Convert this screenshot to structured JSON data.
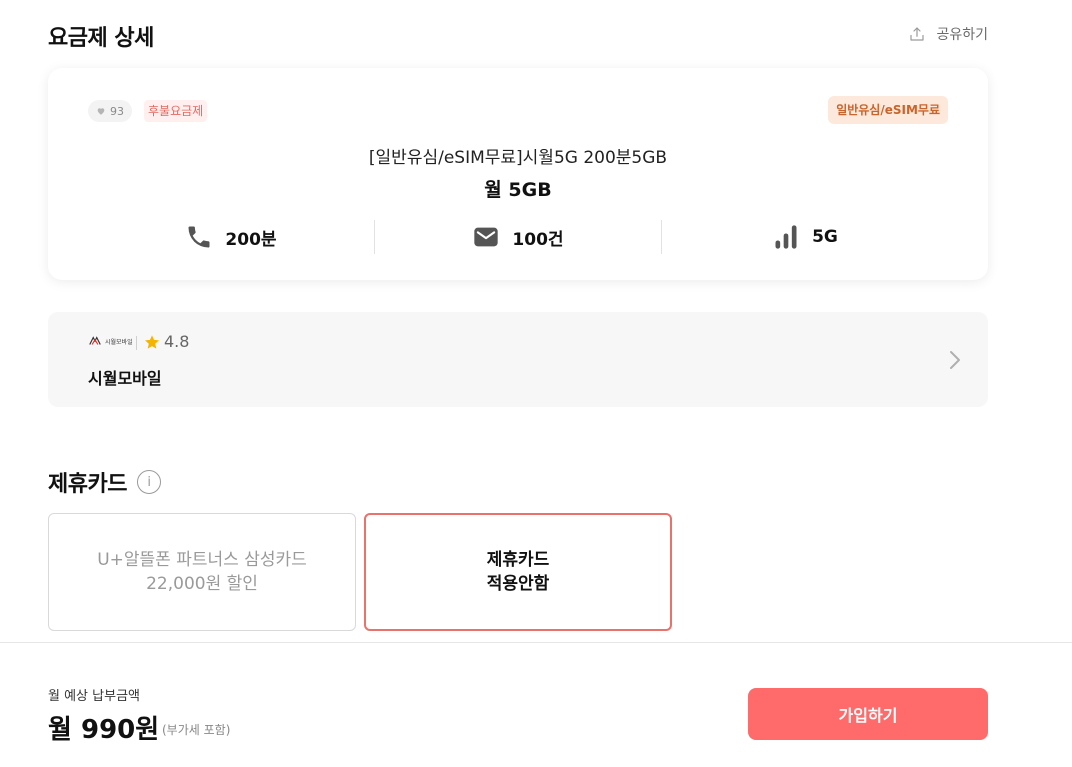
{
  "page": {
    "title": "요금제 상세",
    "share_label": "공유하기"
  },
  "plan": {
    "likes": "93",
    "type_tag": "후불요금제",
    "badge": "일반유심/eSIM무료",
    "name": "[일반유심/eSIM무료]시월5G 200분5GB",
    "data": "월 5GB",
    "specs": {
      "voice": "200분",
      "sms": "100건",
      "network": "5G"
    }
  },
  "mvno": {
    "logo_text": "시월모바일",
    "rating": "4.8",
    "name": "시월모바일"
  },
  "partner_cards": {
    "title": "제휴카드",
    "info_glyph": "i",
    "options": [
      {
        "line1": "U+알뜰폰 파트너스 삼성카드",
        "line2": "22,000원 할인"
      },
      {
        "line1": "제휴카드",
        "line2": "적용안함"
      }
    ]
  },
  "footer": {
    "estimate_label": "월 예상 납부금액",
    "price": "월 990원",
    "vat_note": "(부가세 포함)",
    "join_label": "가입하기"
  },
  "colors": {
    "accent": "#ff6b6b",
    "selected_border": "#e9726c",
    "badge_text": "#c9652c",
    "badge_bg": "#fde9dc",
    "star": "#f5b400"
  }
}
